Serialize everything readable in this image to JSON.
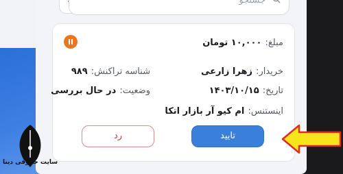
{
  "search": {
    "placeholder": "جستجو"
  },
  "card": {
    "amount_label": "مبلغ:",
    "amount_value": "۱۰,۰۰۰ تومان",
    "buyer_label": "خریدار:",
    "buyer_value": "زهرا زارعی",
    "txn_label": "شناسه تراکنش:",
    "txn_value": "۹۸۹",
    "date_label": "تاریخ:",
    "date_value": "۱۴۰۳/۱۰/۱۵",
    "status_label": "وضعیت:",
    "status_value": "در حال بررسی",
    "instance_label": "اینستنس:",
    "instance_value": "ام کیو آر بازار اتکا"
  },
  "actions": {
    "confirm_label": "تایید",
    "reject_label": "رد"
  },
  "watermark": {
    "site_label": "سایت حقوقی دینا"
  },
  "colors": {
    "confirm_button": "#3a7fd9",
    "reject_border": "#d98b8b",
    "pause_icon": "#e8781f",
    "arrow_fill": "#f7e51c",
    "arrow_stroke": "#e02a2a"
  }
}
